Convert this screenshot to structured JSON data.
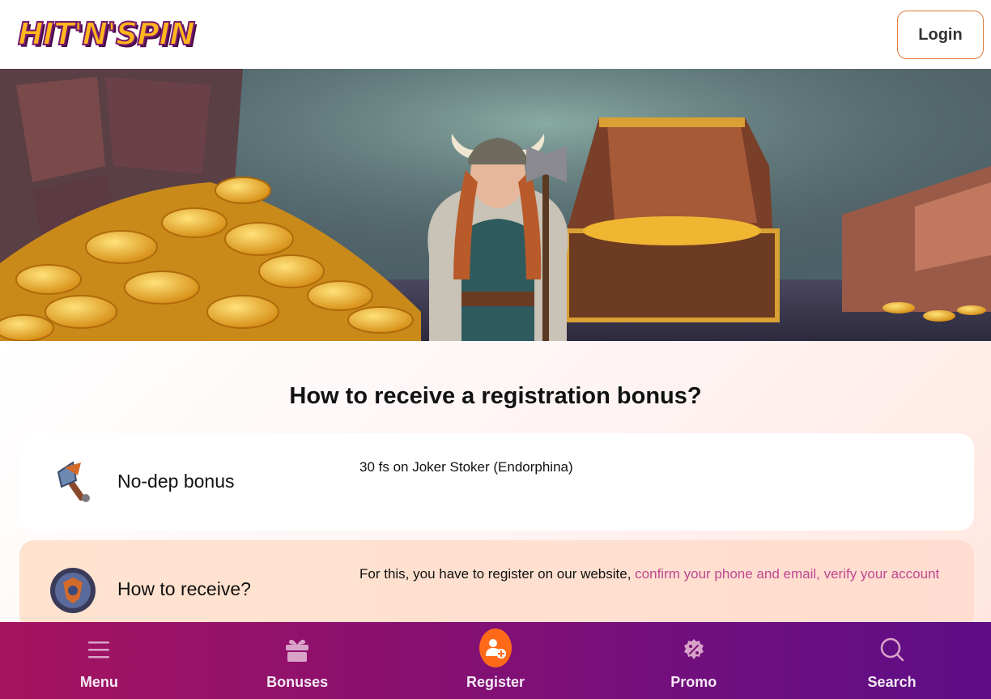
{
  "header": {
    "logo_text": "HIT'N'SPIN",
    "login_label": "Login"
  },
  "section": {
    "title": "How to receive a registration bonus?"
  },
  "cards": [
    {
      "label": "No-dep bonus",
      "text": "30 fs on Joker Stoker (Endorphina)",
      "icon": "axe-icon"
    },
    {
      "label": "How to receive?",
      "text": "For this, you have to register on our website, ",
      "link_text": "confirm your phone and email, verify your account",
      "icon": "shield-icon"
    }
  ],
  "bottom_nav": {
    "items": [
      {
        "label": "Menu",
        "icon": "hamburger-icon"
      },
      {
        "label": "Bonuses",
        "icon": "gift-icon"
      },
      {
        "label": "Register",
        "icon": "add-user-icon"
      },
      {
        "label": "Promo",
        "icon": "discount-icon"
      },
      {
        "label": "Search",
        "icon": "search-icon"
      }
    ]
  },
  "colors": {
    "accent_orange": "#ff6a1a",
    "link_pink": "#c0478f",
    "nav_start": "#a5145f",
    "nav_end": "#5e0d86"
  }
}
